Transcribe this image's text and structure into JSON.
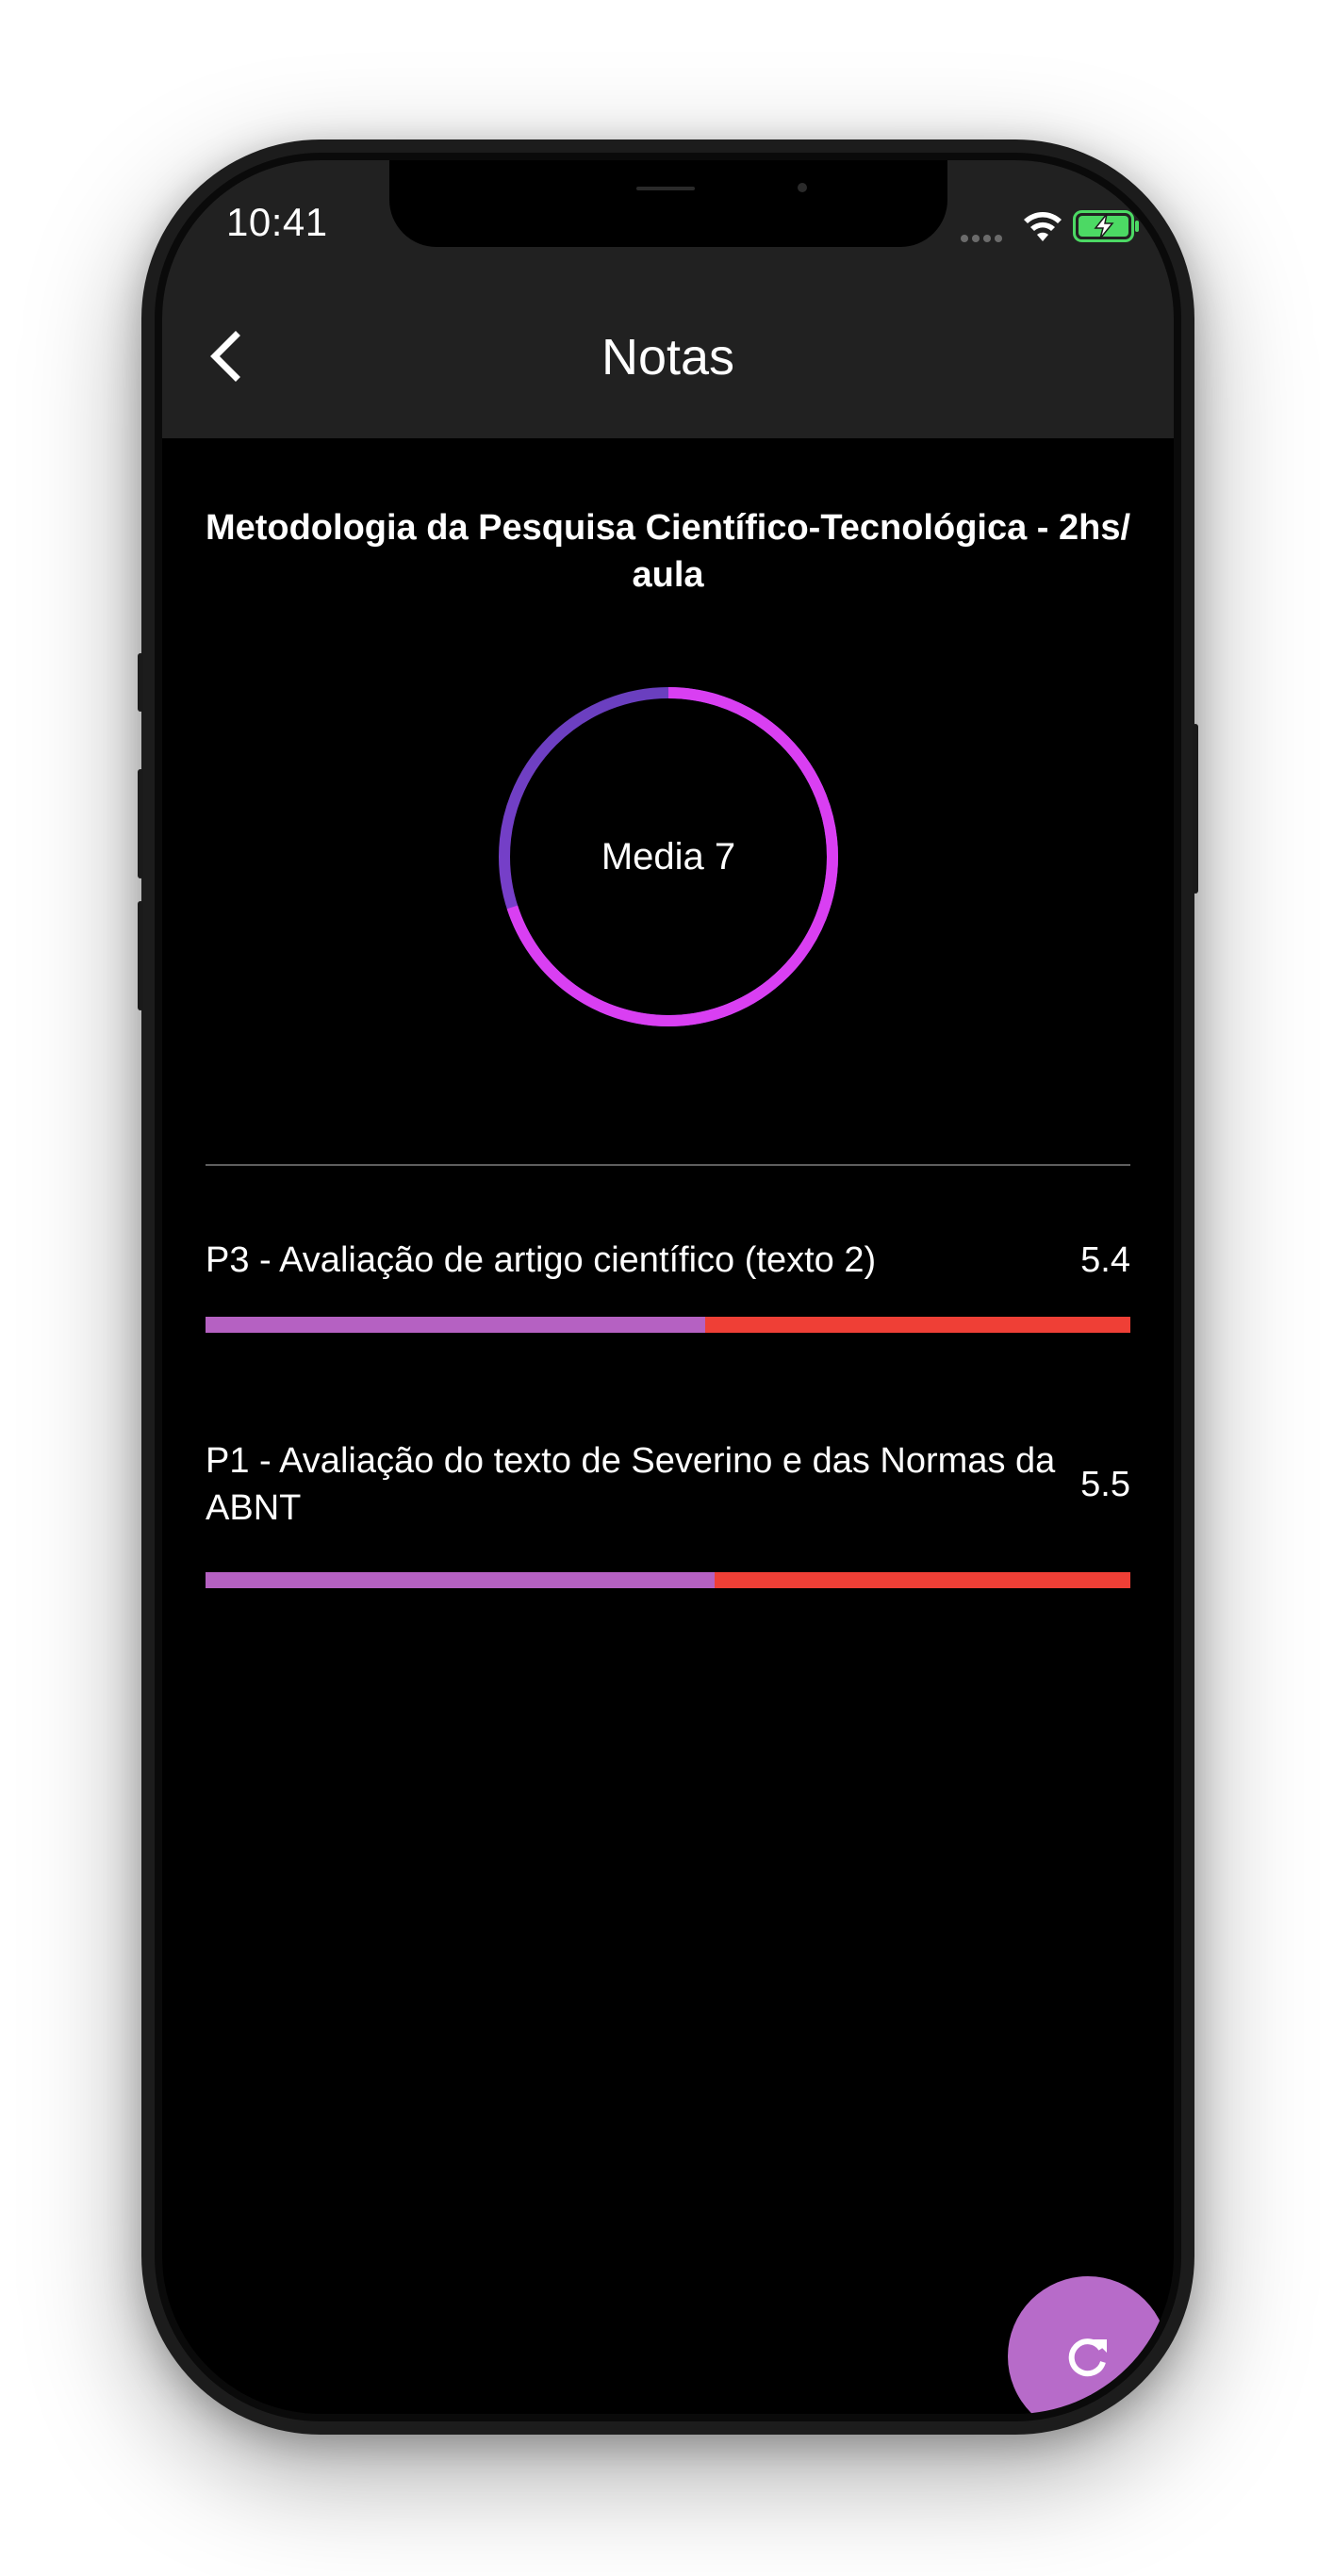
{
  "status_bar": {
    "time": "10:41"
  },
  "nav": {
    "title": "Notas",
    "back_icon": "chevron-left-icon"
  },
  "subject": {
    "title": "Metodologia da Pesquisa Científico-Tecnológica - 2hs/ aula"
  },
  "average": {
    "label": "Media 7",
    "value": 7,
    "max": 10,
    "ring_colors": {
      "primary": "#d93ff2",
      "secondary": "#6a3fbf"
    }
  },
  "grades": [
    {
      "label": "P3 - Avaliação de artigo científico (texto 2)",
      "value_text": "5.4",
      "value": 5.4,
      "max": 10
    },
    {
      "label": "P1 - Avaliação do texto de Severino e das Normas da ABNT",
      "value_text": "5.5",
      "value": 5.5,
      "max": 10
    }
  ],
  "colors": {
    "bar_fill": "#b561c2",
    "bar_track": "#ef3f36",
    "fab": "#b76bc9"
  },
  "fab": {
    "icon": "refresh-icon"
  }
}
